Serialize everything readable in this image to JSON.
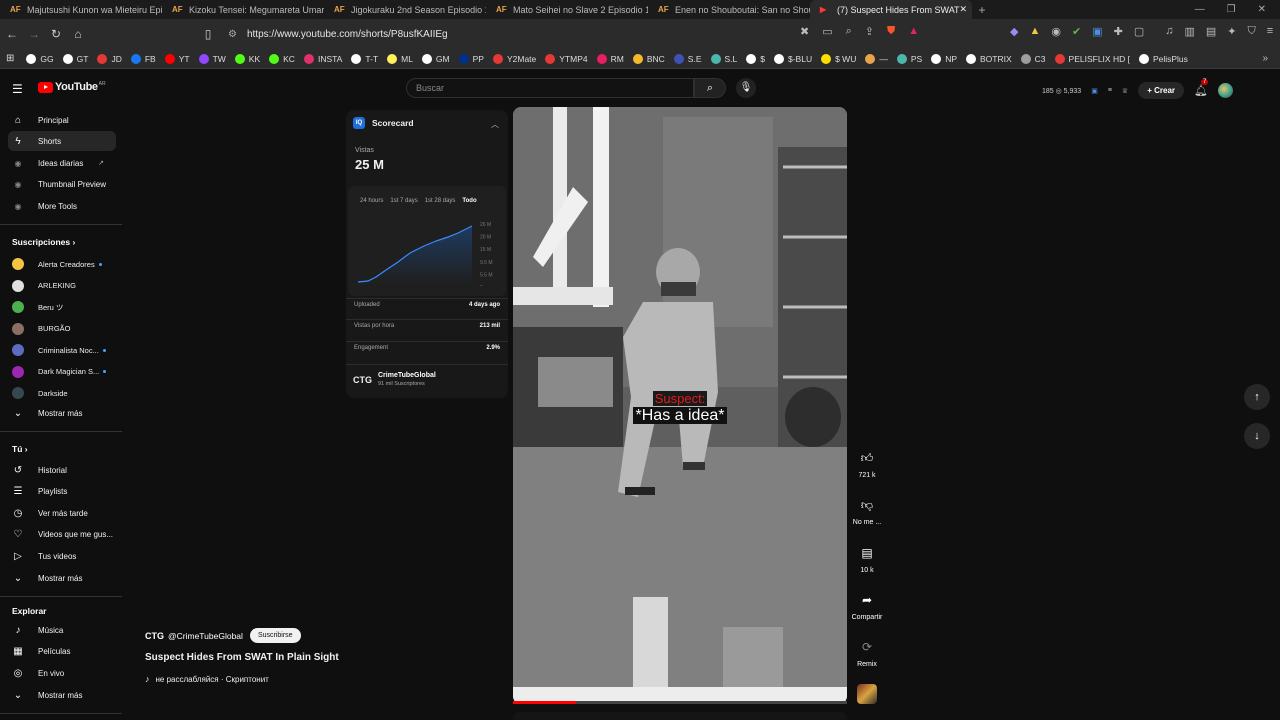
{
  "browser": {
    "tabs": [
      {
        "title": "Majutsushi Kunon wa Mieteiru Episo",
        "fav": "AF"
      },
      {
        "title": "Kizoku Tensei: Megumareta Umare k",
        "fav": "AF"
      },
      {
        "title": "Jigokuraku 2nd Season Episodio 1 Su",
        "fav": "AF"
      },
      {
        "title": "Mato Seihei no Slave 2 Episodio 1 Su",
        "fav": "AF"
      },
      {
        "title": "Enen no Shouboutai: San no Shou Ep",
        "fav": "AF"
      },
      {
        "title": "(7) Suspect Hides From SWAT",
        "fav": "▶"
      }
    ],
    "url": "https://www.youtube.com/shorts/P8usfKAIIEg",
    "bookmarks": [
      {
        "label": "GG",
        "color": "#ffffff"
      },
      {
        "label": "GT",
        "color": "#ffffff"
      },
      {
        "label": "JD",
        "color": "#e53935"
      },
      {
        "label": "FB",
        "color": "#1877f2"
      },
      {
        "label": "YT",
        "color": "#ff0000"
      },
      {
        "label": "TW",
        "color": "#9146ff"
      },
      {
        "label": "KK",
        "color": "#53fc18"
      },
      {
        "label": "KC",
        "color": "#53fc18"
      },
      {
        "label": "INSTA",
        "color": "#e1306c"
      },
      {
        "label": "T-T",
        "color": "#ffffff"
      },
      {
        "label": "ML",
        "color": "#fff159"
      },
      {
        "label": "GM",
        "color": "#ffffff"
      },
      {
        "label": "PP",
        "color": "#003087"
      },
      {
        "label": "Y2Mate",
        "color": "#e53935"
      },
      {
        "label": "YTMP4",
        "color": "#e53935"
      },
      {
        "label": "RM",
        "color": "#e91e63"
      },
      {
        "label": "BNC",
        "color": "#f3ba2f"
      },
      {
        "label": "S.E",
        "color": "#3f51b5"
      },
      {
        "label": "S.L",
        "color": "#4db6ac"
      },
      {
        "label": "$",
        "color": "#ffffff"
      },
      {
        "label": "$-BLU",
        "color": "#ffffff"
      },
      {
        "label": "$ WU",
        "color": "#ffdd00"
      },
      {
        "label": "—",
        "color": "#e8a44a"
      },
      {
        "label": "PS",
        "color": "#4db6ac"
      },
      {
        "label": "NP",
        "color": "#ffffff"
      },
      {
        "label": "BOTRIX",
        "color": "#ffffff"
      },
      {
        "label": "C3",
        "color": "#9e9e9e"
      },
      {
        "label": "PELISFLIX HD [",
        "color": "#e53935"
      },
      {
        "label": "PelisPlus",
        "color": "#ffffff"
      }
    ]
  },
  "youtube": {
    "logo_text": "YouTube",
    "logo_country": "AR",
    "search_placeholder": "Buscar",
    "header_stats": "185 ◎ 5,933",
    "create_label": "Crear",
    "notif_count": "7",
    "sidebar": {
      "main": [
        {
          "label": "Principal",
          "icon": "home-icon",
          "glyph": "⌂"
        },
        {
          "label": "Shorts",
          "icon": "shorts-icon",
          "glyph": "ϟ",
          "active": true
        },
        {
          "label": "Ideas diarias",
          "icon": "ideas-icon",
          "glyph": "◉"
        },
        {
          "label": "Thumbnail Preview",
          "icon": "thumbnail-icon",
          "glyph": "◉"
        },
        {
          "label": "More Tools",
          "icon": "tools-icon",
          "glyph": "◉"
        }
      ],
      "subs_title": "Suscripciones",
      "subs": [
        {
          "label": "Alerta Creadores",
          "color": "#f5c542",
          "live": true
        },
        {
          "label": "ARLEKING",
          "color": "#e0e0e0",
          "live": false
        },
        {
          "label": "Beru ツ",
          "color": "#4caf50",
          "live": false
        },
        {
          "label": "BURGÃO",
          "color": "#8d6e63",
          "live": false
        },
        {
          "label": "Criminalista Noc...",
          "color": "#5c6bc0",
          "live": true
        },
        {
          "label": "Dark Magician S...",
          "color": "#9c27b0",
          "live": true
        },
        {
          "label": "Darkside",
          "color": "#37474f",
          "live": false
        }
      ],
      "more_label": "Mostrar más",
      "you_title": "Tú",
      "you": [
        {
          "label": "Historial",
          "glyph": "↺"
        },
        {
          "label": "Playlists",
          "glyph": "☰"
        },
        {
          "label": "Ver más tarde",
          "glyph": "◷"
        },
        {
          "label": "Videos que me gus...",
          "glyph": "♡"
        },
        {
          "label": "Tus videos",
          "glyph": "▷"
        }
      ],
      "explore_title": "Explorar",
      "explore": [
        {
          "label": "Música",
          "glyph": "♪"
        },
        {
          "label": "Películas",
          "glyph": "▦"
        },
        {
          "label": "En vivo",
          "glyph": "◎"
        }
      ]
    },
    "scorecard": {
      "title": "Scorecard",
      "views_label": "Vistas",
      "views_value": "25 M",
      "tabs": [
        "24 hours",
        "1st 7 days",
        "1st 28 days",
        "Todo"
      ],
      "active_tab": "Todo",
      "y_ticks": [
        "26 M",
        "20 M",
        "15 M",
        "9.5 M",
        "5.5 M",
        "0"
      ],
      "rows": [
        {
          "label": "Uploaded",
          "value": "4 days ago"
        },
        {
          "label": "Vistas por hora",
          "value": "213 mil"
        },
        {
          "label": "Engagement",
          "value": "2.9%"
        }
      ],
      "channel_name": "CrimeTubeGlobal",
      "channel_subs": "91 mil Suscriptores",
      "channel_abbr": "CTG"
    },
    "short": {
      "caption_speaker": "Suspect:",
      "caption_text": "*Has a idea*",
      "channel_abbr": "CTG",
      "channel_handle": "@CrimeTubeGlobal",
      "subscribe_label": "Suscribirse",
      "title": "Suspect Hides From SWAT In Plain Sight",
      "music": "не расслабляйся · Скриптонит",
      "progress": 0.19,
      "likes": "721 k",
      "dislike_label": "No me ...",
      "comments": "10 k",
      "share_label": "Compartir",
      "remix_label": "Remix"
    }
  }
}
